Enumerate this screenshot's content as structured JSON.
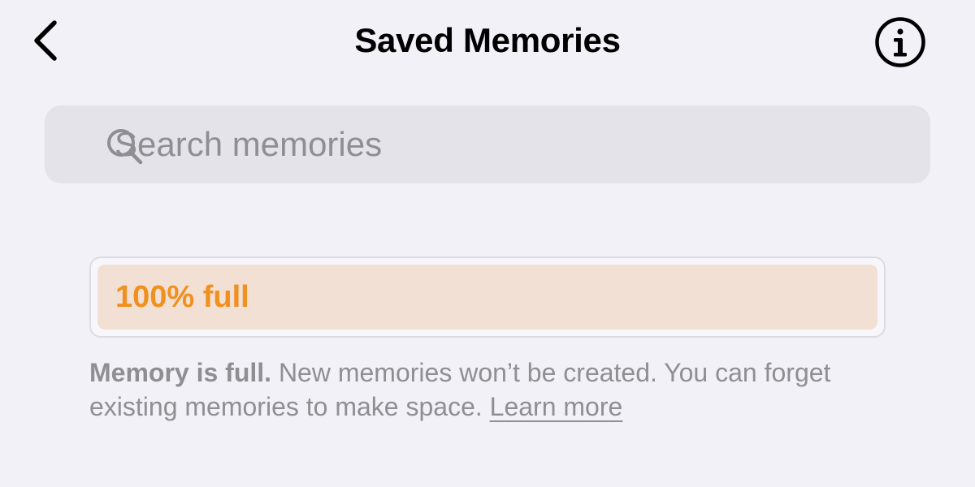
{
  "header": {
    "title": "Saved Memories",
    "back_icon": "chevron-left-icon",
    "info_icon": "info-circle-icon"
  },
  "search": {
    "placeholder": "Search memories",
    "value": "",
    "icon": "search-icon"
  },
  "memory_meter": {
    "label": "100% full",
    "fill_percent": 100,
    "fill_color": "#f2e0d4",
    "label_color": "#f0901f"
  },
  "notice": {
    "bold_text": "Memory is full.",
    "body_text": " New memories won’t be created. You can forget existing memories to make space. ",
    "link_text": "Learn more"
  },
  "colors": {
    "background": "#f2f1f7",
    "search_background": "#e4e3ea",
    "secondary_text": "#8e8e93"
  }
}
